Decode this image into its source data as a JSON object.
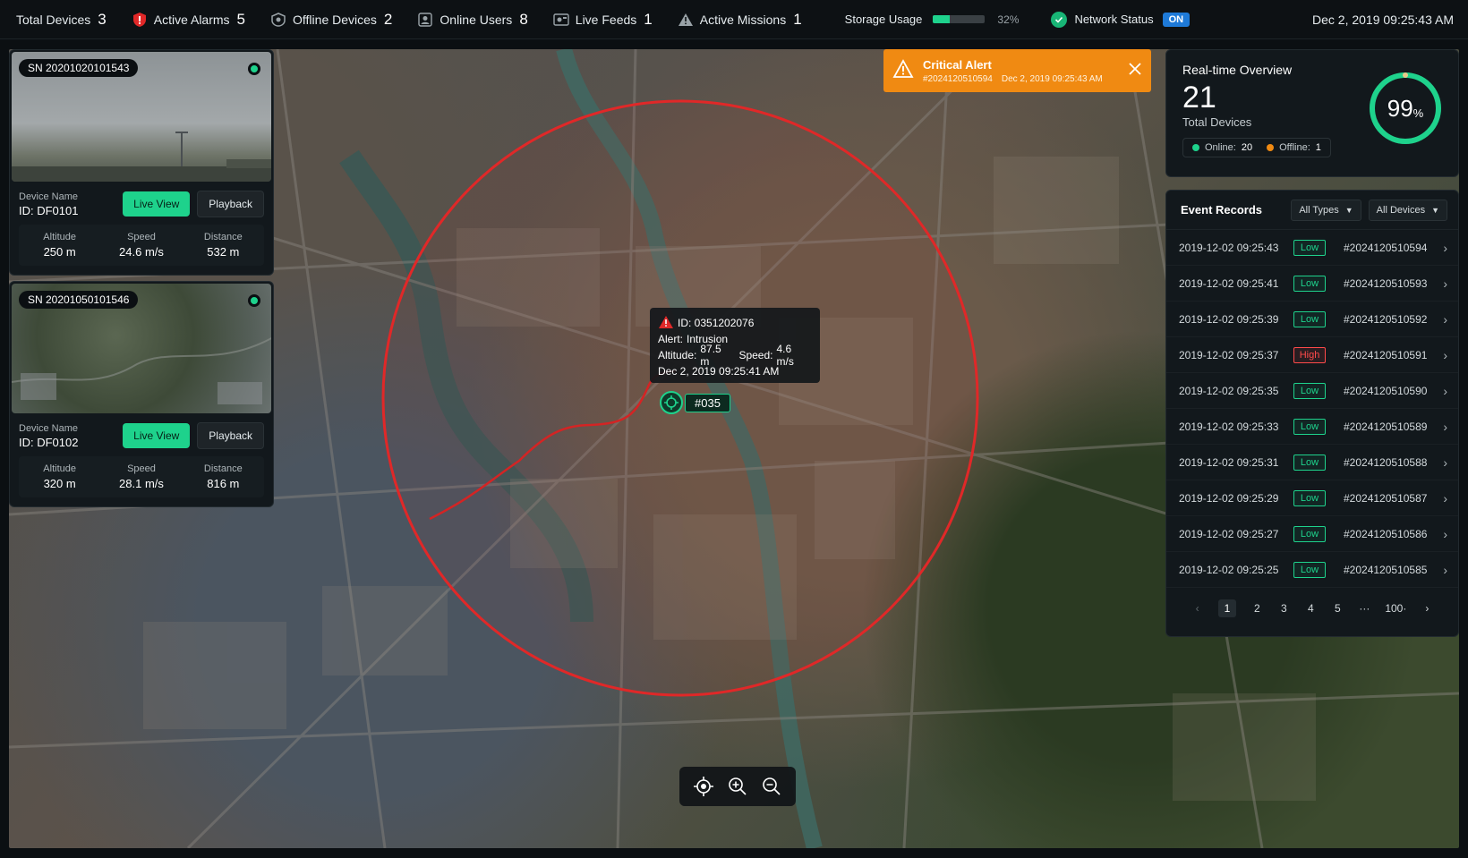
{
  "topbar": {
    "total_devices": {
      "label": "Total Devices",
      "value": "3"
    },
    "active_alarms": {
      "label": "Active Alarms",
      "value": "5"
    },
    "offline_devices": {
      "label": "Offline Devices",
      "value": "2"
    },
    "online_users": {
      "label": "Online Users",
      "value": "8"
    },
    "live_feeds": {
      "label": "Live Feeds",
      "value": "1"
    },
    "active_missions": {
      "label": "Active Missions",
      "value": "1"
    },
    "storage": {
      "label": "Storage Usage",
      "percent_text": "32%",
      "fraction": 0.32
    },
    "network": {
      "label": "Network Status",
      "state": "ON"
    },
    "datetime": "Dec 2, 2019 09:25:43 AM"
  },
  "devices": [
    {
      "sn": "SN 20201020101543",
      "name_label": "Device Name",
      "id": "ID: DF0101",
      "live_label": "Live View",
      "playback_label": "Playback",
      "altitude_label": "Altitude",
      "altitude": "250 m",
      "speed_label": "Speed",
      "speed": "24.6 m/s",
      "distance_label": "Distance",
      "distance": "532 m"
    },
    {
      "sn": "SN 20201050101546",
      "name_label": "Device Name",
      "id": "ID: DF0102",
      "live_label": "Live View",
      "playback_label": "Playback",
      "altitude_label": "Altitude",
      "altitude": "320 m",
      "speed_label": "Speed",
      "speed": "28.1 m/s",
      "distance_label": "Distance",
      "distance": "816 m"
    }
  ],
  "critical_alert": {
    "title": "Critical Alert",
    "id": "#2024120510594",
    "time": "Dec 2, 2019 09:25:43 AM"
  },
  "tooltip": {
    "id": "ID: 0351202076",
    "alert_label": "Alert:",
    "alert": "Intrusion",
    "altitude_label": "Altitude:",
    "altitude": "87.5 m",
    "speed_label": "Speed:",
    "speed": "4.6 m/s",
    "time": "Dec 2, 2019 09:25:41 AM"
  },
  "marker": {
    "label": "#035"
  },
  "overview": {
    "title": "Real-time Overview",
    "total": "21",
    "total_label": "Total Devices",
    "online_label": "Online:",
    "online": "20",
    "offline_label": "Offline:",
    "offline": "1",
    "percent": "99",
    "percent_unit": "%",
    "fraction": 0.99
  },
  "events": {
    "title": "Event Records",
    "type_filter": "All Types",
    "device_filter": "All Devices",
    "rows": [
      {
        "ts": "2019-12-02 09:25:43",
        "level": "Low",
        "id": "#2024120510594"
      },
      {
        "ts": "2019-12-02 09:25:41",
        "level": "Low",
        "id": "#2024120510593"
      },
      {
        "ts": "2019-12-02 09:25:39",
        "level": "Low",
        "id": "#2024120510592"
      },
      {
        "ts": "2019-12-02 09:25:37",
        "level": "High",
        "id": "#2024120510591"
      },
      {
        "ts": "2019-12-02 09:25:35",
        "level": "Low",
        "id": "#2024120510590"
      },
      {
        "ts": "2019-12-02 09:25:33",
        "level": "Low",
        "id": "#2024120510589"
      },
      {
        "ts": "2019-12-02 09:25:31",
        "level": "Low",
        "id": "#2024120510588"
      },
      {
        "ts": "2019-12-02 09:25:29",
        "level": "Low",
        "id": "#2024120510587"
      },
      {
        "ts": "2019-12-02 09:25:27",
        "level": "Low",
        "id": "#2024120510586"
      },
      {
        "ts": "2019-12-02 09:25:25",
        "level": "Low",
        "id": "#2024120510585"
      }
    ],
    "pagination": {
      "pages": [
        "1",
        "2",
        "3",
        "4",
        "5"
      ],
      "ellipsis": "···",
      "last": "100·",
      "current": "1"
    }
  },
  "colors": {
    "accent": "#1ed28c",
    "alert": "#f08a12",
    "danger": "#ff4a4a",
    "info": "#1e7ad8"
  },
  "icons": {
    "alarms": "shield-alarm-icon",
    "offline": "offline-device-icon",
    "users": "user-icon",
    "feeds": "video-feed-icon",
    "missions": "warning-triangle-icon",
    "network": "check-circle-icon",
    "alert": "warning-triangle-icon",
    "close": "close-icon",
    "locate": "locate-icon",
    "zoom_in": "zoom-in-icon",
    "zoom_out": "zoom-out-icon"
  }
}
